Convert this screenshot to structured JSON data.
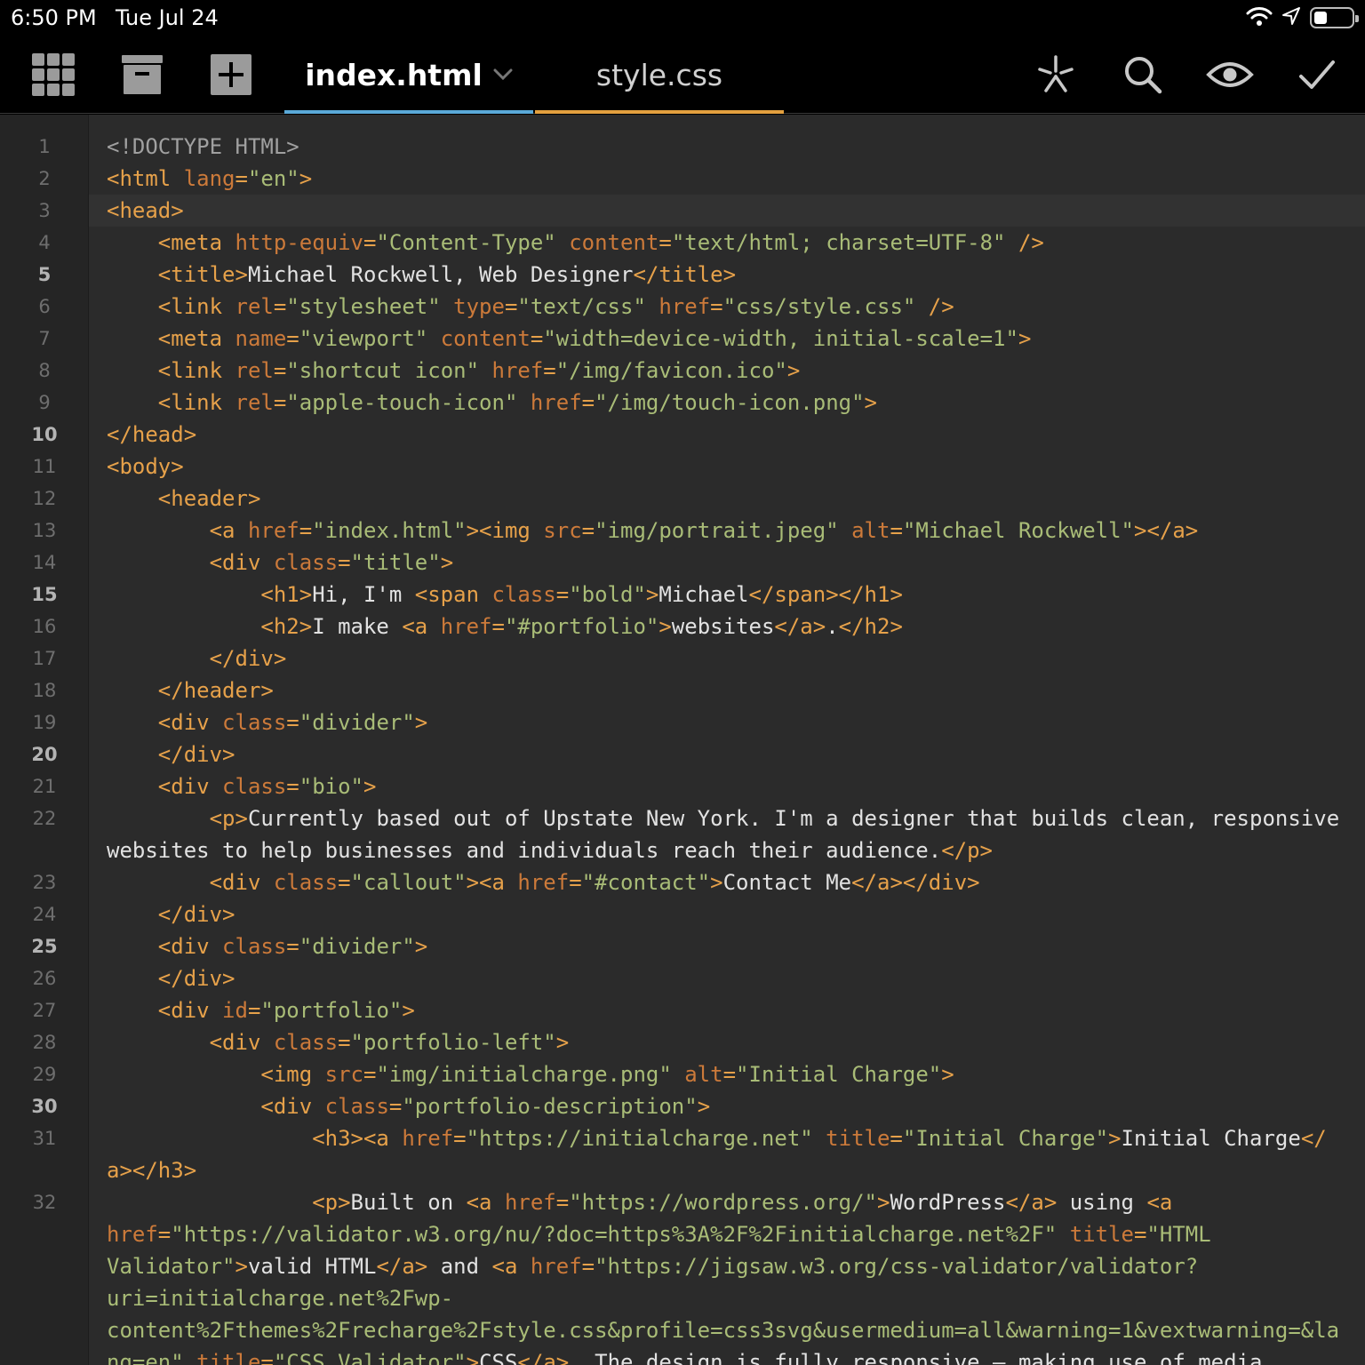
{
  "status": {
    "time": "6:50 PM",
    "date": "Tue Jul 24",
    "battery_level": 0.35
  },
  "toolbar": {
    "icons": [
      "grid-icon",
      "archive-icon",
      "add-icon",
      "snippet-icon",
      "search-icon",
      "preview-eye-icon",
      "checkmark-icon"
    ],
    "tabs": [
      {
        "label": "index.html",
        "active": true,
        "color": "#5aa9d8"
      },
      {
        "label": "style.css",
        "active": false,
        "color": "#e3a03f"
      }
    ]
  },
  "colors": {
    "tag": "#e6a14a",
    "attr": "#cc7a3a",
    "string": "#a9bc77",
    "text": "#e2e2e2",
    "doctype": "#a0a0a0",
    "editor_bg": "#2b2b2b",
    "gutter_bg": "#252525"
  },
  "editor": {
    "language": "html",
    "current_line": 3,
    "bold_line_numbers": [
      5,
      10,
      15,
      20,
      25,
      30
    ],
    "lines": [
      {
        "n": 1,
        "tokens": [
          [
            "doc",
            "<!DOCTYPE HTML>"
          ]
        ]
      },
      {
        "n": 2,
        "tokens": [
          [
            "tag",
            "<html "
          ],
          [
            "attr",
            "lang"
          ],
          [
            "tag",
            "="
          ],
          [
            "str",
            "\"en\""
          ],
          [
            "tag",
            ">"
          ]
        ]
      },
      {
        "n": 3,
        "tokens": [
          [
            "tag",
            "<head>"
          ]
        ]
      },
      {
        "n": 4,
        "tokens": [
          [
            "txt",
            "    "
          ],
          [
            "tag",
            "<meta "
          ],
          [
            "attr",
            "http-equiv"
          ],
          [
            "tag",
            "="
          ],
          [
            "str",
            "\"Content-Type\" "
          ],
          [
            "attr",
            "content"
          ],
          [
            "tag",
            "="
          ],
          [
            "str",
            "\"text/html; charset=UTF-8\" "
          ],
          [
            "tag",
            "/>"
          ]
        ]
      },
      {
        "n": 5,
        "tokens": [
          [
            "txt",
            "    "
          ],
          [
            "tag",
            "<title>"
          ],
          [
            "txt",
            "Michael Rockwell, Web Designer"
          ],
          [
            "tag",
            "</title>"
          ]
        ]
      },
      {
        "n": 6,
        "tokens": [
          [
            "txt",
            "    "
          ],
          [
            "tag",
            "<link "
          ],
          [
            "attr",
            "rel"
          ],
          [
            "tag",
            "="
          ],
          [
            "str",
            "\"stylesheet\" "
          ],
          [
            "attr",
            "type"
          ],
          [
            "tag",
            "="
          ],
          [
            "str",
            "\"text/css\" "
          ],
          [
            "attr",
            "href"
          ],
          [
            "tag",
            "="
          ],
          [
            "str",
            "\"css/style.css\" "
          ],
          [
            "tag",
            "/>"
          ]
        ]
      },
      {
        "n": 7,
        "tokens": [
          [
            "txt",
            "    "
          ],
          [
            "tag",
            "<meta "
          ],
          [
            "attr",
            "name"
          ],
          [
            "tag",
            "="
          ],
          [
            "str",
            "\"viewport\" "
          ],
          [
            "attr",
            "content"
          ],
          [
            "tag",
            "="
          ],
          [
            "str",
            "\"width=device-width, initial-scale=1\""
          ],
          [
            "tag",
            ">"
          ]
        ]
      },
      {
        "n": 8,
        "tokens": [
          [
            "txt",
            "    "
          ],
          [
            "tag",
            "<link "
          ],
          [
            "attr",
            "rel"
          ],
          [
            "tag",
            "="
          ],
          [
            "str",
            "\"shortcut icon\" "
          ],
          [
            "attr",
            "href"
          ],
          [
            "tag",
            "="
          ],
          [
            "str",
            "\"/img/favicon.ico\""
          ],
          [
            "tag",
            ">"
          ]
        ]
      },
      {
        "n": 9,
        "tokens": [
          [
            "txt",
            "    "
          ],
          [
            "tag",
            "<link "
          ],
          [
            "attr",
            "rel"
          ],
          [
            "tag",
            "="
          ],
          [
            "str",
            "\"apple-touch-icon\" "
          ],
          [
            "attr",
            "href"
          ],
          [
            "tag",
            "="
          ],
          [
            "str",
            "\"/img/touch-icon.png\""
          ],
          [
            "tag",
            ">"
          ]
        ]
      },
      {
        "n": 10,
        "tokens": [
          [
            "tag",
            "</head>"
          ]
        ]
      },
      {
        "n": 11,
        "tokens": [
          [
            "tag",
            "<body>"
          ]
        ]
      },
      {
        "n": 12,
        "tokens": [
          [
            "txt",
            "    "
          ],
          [
            "tag",
            "<header>"
          ]
        ]
      },
      {
        "n": 13,
        "tokens": [
          [
            "txt",
            "        "
          ],
          [
            "tag",
            "<a "
          ],
          [
            "attr",
            "href"
          ],
          [
            "tag",
            "="
          ],
          [
            "str",
            "\"index.html\""
          ],
          [
            "tag",
            "><img "
          ],
          [
            "attr",
            "src"
          ],
          [
            "tag",
            "="
          ],
          [
            "str",
            "\"img/portrait.jpeg\" "
          ],
          [
            "attr",
            "alt"
          ],
          [
            "tag",
            "="
          ],
          [
            "str",
            "\"Michael Rockwell\""
          ],
          [
            "tag",
            "></a>"
          ]
        ]
      },
      {
        "n": 14,
        "tokens": [
          [
            "txt",
            "        "
          ],
          [
            "tag",
            "<div "
          ],
          [
            "attr",
            "class"
          ],
          [
            "tag",
            "="
          ],
          [
            "str",
            "\"title\""
          ],
          [
            "tag",
            ">"
          ]
        ]
      },
      {
        "n": 15,
        "tokens": [
          [
            "txt",
            "            "
          ],
          [
            "tag",
            "<h1>"
          ],
          [
            "txt",
            "Hi, I'm "
          ],
          [
            "tag",
            "<span "
          ],
          [
            "attr",
            "class"
          ],
          [
            "tag",
            "="
          ],
          [
            "str",
            "\"bold\""
          ],
          [
            "tag",
            ">"
          ],
          [
            "txt",
            "Michael"
          ],
          [
            "tag",
            "</span></h1>"
          ]
        ]
      },
      {
        "n": 16,
        "tokens": [
          [
            "txt",
            "            "
          ],
          [
            "tag",
            "<h2>"
          ],
          [
            "txt",
            "I make "
          ],
          [
            "tag",
            "<a "
          ],
          [
            "attr",
            "href"
          ],
          [
            "tag",
            "="
          ],
          [
            "str",
            "\"#portfolio\""
          ],
          [
            "tag",
            ">"
          ],
          [
            "txt",
            "websites"
          ],
          [
            "tag",
            "</a>"
          ],
          [
            "txt",
            "."
          ],
          [
            "tag",
            "</h2>"
          ]
        ]
      },
      {
        "n": 17,
        "tokens": [
          [
            "txt",
            "        "
          ],
          [
            "tag",
            "</div>"
          ]
        ]
      },
      {
        "n": 18,
        "tokens": [
          [
            "txt",
            "    "
          ],
          [
            "tag",
            "</header>"
          ]
        ]
      },
      {
        "n": 19,
        "tokens": [
          [
            "txt",
            "    "
          ],
          [
            "tag",
            "<div "
          ],
          [
            "attr",
            "class"
          ],
          [
            "tag",
            "="
          ],
          [
            "str",
            "\"divider\""
          ],
          [
            "tag",
            ">"
          ]
        ]
      },
      {
        "n": 20,
        "tokens": [
          [
            "txt",
            "    "
          ],
          [
            "tag",
            "</div>"
          ]
        ]
      },
      {
        "n": 21,
        "tokens": [
          [
            "txt",
            "    "
          ],
          [
            "tag",
            "<div "
          ],
          [
            "attr",
            "class"
          ],
          [
            "tag",
            "="
          ],
          [
            "str",
            "\"bio\""
          ],
          [
            "tag",
            ">"
          ]
        ]
      },
      {
        "n": 22,
        "tokens": [
          [
            "txt",
            "        "
          ],
          [
            "tag",
            "<p>"
          ],
          [
            "txt",
            "Currently based out of Upstate New York. I'm a designer that builds clean, responsive "
          ]
        ]
      },
      {
        "n": null,
        "tokens": [
          [
            "txt",
            "websites to help businesses and individuals reach their audience."
          ],
          [
            "tag",
            "</p>"
          ]
        ]
      },
      {
        "n": 23,
        "tokens": [
          [
            "txt",
            "        "
          ],
          [
            "tag",
            "<div "
          ],
          [
            "attr",
            "class"
          ],
          [
            "tag",
            "="
          ],
          [
            "str",
            "\"callout\""
          ],
          [
            "tag",
            "><a "
          ],
          [
            "attr",
            "href"
          ],
          [
            "tag",
            "="
          ],
          [
            "str",
            "\"#contact\""
          ],
          [
            "tag",
            ">"
          ],
          [
            "txt",
            "Contact Me"
          ],
          [
            "tag",
            "</a></div>"
          ]
        ]
      },
      {
        "n": 24,
        "tokens": [
          [
            "txt",
            "    "
          ],
          [
            "tag",
            "</div>"
          ]
        ]
      },
      {
        "n": 25,
        "tokens": [
          [
            "txt",
            "    "
          ],
          [
            "tag",
            "<div "
          ],
          [
            "attr",
            "class"
          ],
          [
            "tag",
            "="
          ],
          [
            "str",
            "\"divider\""
          ],
          [
            "tag",
            ">"
          ]
        ]
      },
      {
        "n": 26,
        "tokens": [
          [
            "txt",
            "    "
          ],
          [
            "tag",
            "</div>"
          ]
        ]
      },
      {
        "n": 27,
        "tokens": [
          [
            "txt",
            "    "
          ],
          [
            "tag",
            "<div "
          ],
          [
            "attr",
            "id"
          ],
          [
            "tag",
            "="
          ],
          [
            "str",
            "\"portfolio\""
          ],
          [
            "tag",
            ">"
          ]
        ]
      },
      {
        "n": 28,
        "tokens": [
          [
            "txt",
            "        "
          ],
          [
            "tag",
            "<div "
          ],
          [
            "attr",
            "class"
          ],
          [
            "tag",
            "="
          ],
          [
            "str",
            "\"portfolio-left\""
          ],
          [
            "tag",
            ">"
          ]
        ]
      },
      {
        "n": 29,
        "tokens": [
          [
            "txt",
            "            "
          ],
          [
            "tag",
            "<img "
          ],
          [
            "attr",
            "src"
          ],
          [
            "tag",
            "="
          ],
          [
            "str",
            "\"img/initialcharge.png\" "
          ],
          [
            "attr",
            "alt"
          ],
          [
            "tag",
            "="
          ],
          [
            "str",
            "\"Initial Charge\""
          ],
          [
            "tag",
            ">"
          ]
        ]
      },
      {
        "n": 30,
        "tokens": [
          [
            "txt",
            "            "
          ],
          [
            "tag",
            "<div "
          ],
          [
            "attr",
            "class"
          ],
          [
            "tag",
            "="
          ],
          [
            "str",
            "\"portfolio-description\""
          ],
          [
            "tag",
            ">"
          ]
        ]
      },
      {
        "n": 31,
        "tokens": [
          [
            "txt",
            "                "
          ],
          [
            "tag",
            "<h3><a "
          ],
          [
            "attr",
            "href"
          ],
          [
            "tag",
            "="
          ],
          [
            "str",
            "\"https://initialcharge.net\" "
          ],
          [
            "attr",
            "title"
          ],
          [
            "tag",
            "="
          ],
          [
            "str",
            "\"Initial Charge\""
          ],
          [
            "tag",
            ">"
          ],
          [
            "txt",
            "Initial Charge"
          ],
          [
            "tag",
            "</"
          ]
        ]
      },
      {
        "n": null,
        "tokens": [
          [
            "tag",
            "a></h3>"
          ]
        ]
      },
      {
        "n": 32,
        "tokens": [
          [
            "txt",
            "                "
          ],
          [
            "tag",
            "<p>"
          ],
          [
            "txt",
            "Built on "
          ],
          [
            "tag",
            "<a "
          ],
          [
            "attr",
            "href"
          ],
          [
            "tag",
            "="
          ],
          [
            "str",
            "\"https://wordpress.org/\""
          ],
          [
            "tag",
            ">"
          ],
          [
            "txt",
            "WordPress"
          ],
          [
            "tag",
            "</a>"
          ],
          [
            "txt",
            " using "
          ],
          [
            "tag",
            "<a"
          ]
        ]
      },
      {
        "n": null,
        "tokens": [
          [
            "attr",
            "href"
          ],
          [
            "tag",
            "="
          ],
          [
            "str",
            "\"https://validator.w3.org/nu/?doc=https%3A%2F%2Finitialcharge.net%2F\" "
          ],
          [
            "attr",
            "title"
          ],
          [
            "tag",
            "="
          ],
          [
            "str",
            "\"HTML"
          ]
        ]
      },
      {
        "n": null,
        "tokens": [
          [
            "str",
            "Validator\""
          ],
          [
            "tag",
            ">"
          ],
          [
            "txt",
            "valid HTML"
          ],
          [
            "tag",
            "</a>"
          ],
          [
            "txt",
            " and "
          ],
          [
            "tag",
            "<a "
          ],
          [
            "attr",
            "href"
          ],
          [
            "tag",
            "="
          ],
          [
            "str",
            "\"https://jigsaw.w3.org/css-validator/validator?"
          ]
        ]
      },
      {
        "n": null,
        "tokens": [
          [
            "str",
            "uri=initialcharge.net%2Fwp-"
          ]
        ]
      },
      {
        "n": null,
        "tokens": [
          [
            "str",
            "content%2Fthemes%2Frecharge%2Fstyle.css&profile=css3svg&usermedium=all&warning=1&vextwarning=&la"
          ]
        ]
      },
      {
        "n": null,
        "tokens": [
          [
            "str",
            "ng=en\" "
          ],
          [
            "attr",
            "title"
          ],
          [
            "tag",
            "="
          ],
          [
            "str",
            "\"CSS Validator\""
          ],
          [
            "tag",
            ">"
          ],
          [
            "txt",
            "CSS"
          ],
          [
            "tag",
            "</a>"
          ],
          [
            "txt",
            ". The design is fully responsive — making use of media"
          ]
        ]
      }
    ]
  }
}
